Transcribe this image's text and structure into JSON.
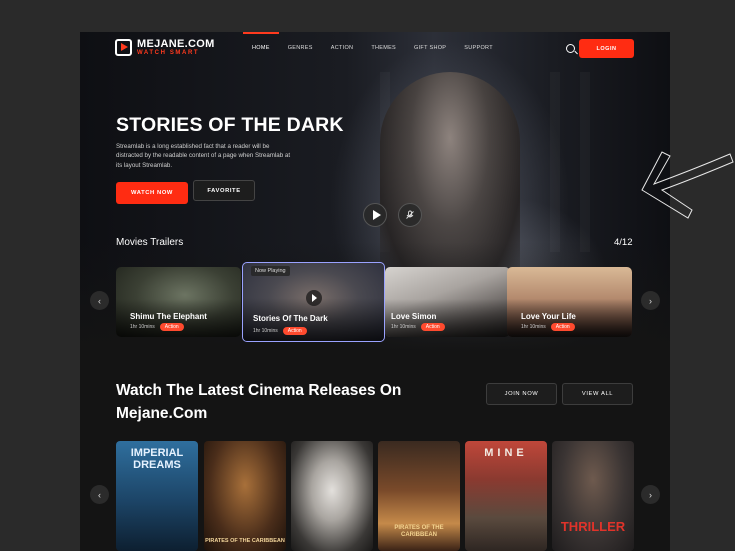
{
  "logo": {
    "name": "MEJANE.COM",
    "tagline": "WATCH SMART"
  },
  "nav": {
    "items": [
      "HOME",
      "GENRES",
      "ACTION",
      "THEMES",
      "GIFT SHOP",
      "SUPPORT"
    ],
    "active": "HOME"
  },
  "header": {
    "login_label": "LOGIN"
  },
  "hero": {
    "title": "STORIES OF THE DARK",
    "description": "Streamlab is a long established fact that a reader will be distracted by the readable content of a page when Streamlab at its layout Streamlab.",
    "watch_label": "WATCH NOW",
    "favorite_label": "FAVORITE"
  },
  "trailers": {
    "title": "Movies Trailers",
    "counter": "4/12",
    "now_playing_label": "Now Playing",
    "items": [
      {
        "title": "Shimu The Elephant",
        "duration": "1hr 10mins",
        "genre": "Action"
      },
      {
        "title": "Stories Of The Dark",
        "duration": "1hr 10mins",
        "genre": "Action"
      },
      {
        "title": "Love Simon",
        "duration": "1hr 10mins",
        "genre": "Action"
      },
      {
        "title": "Love Your Life",
        "duration": "1hr 10mins",
        "genre": "Action"
      }
    ]
  },
  "latest": {
    "title": "Watch The Latest Cinema Releases On Mejane.Com",
    "join_label": "JOIN NOW",
    "view_all_label": "VIEW ALL",
    "posters": [
      {
        "text": "IMPERIAL DREAMS"
      },
      {
        "text": "PIRATES OF THE CARIBBEAN"
      },
      {
        "text": ""
      },
      {
        "text": "PIRATES OF THE CARIBBEAN"
      },
      {
        "text": "MINE"
      },
      {
        "text": "THRILLER"
      }
    ]
  },
  "colors": {
    "accent": "#ff2c12",
    "background": "#141414",
    "page": "#2a2a2a"
  }
}
